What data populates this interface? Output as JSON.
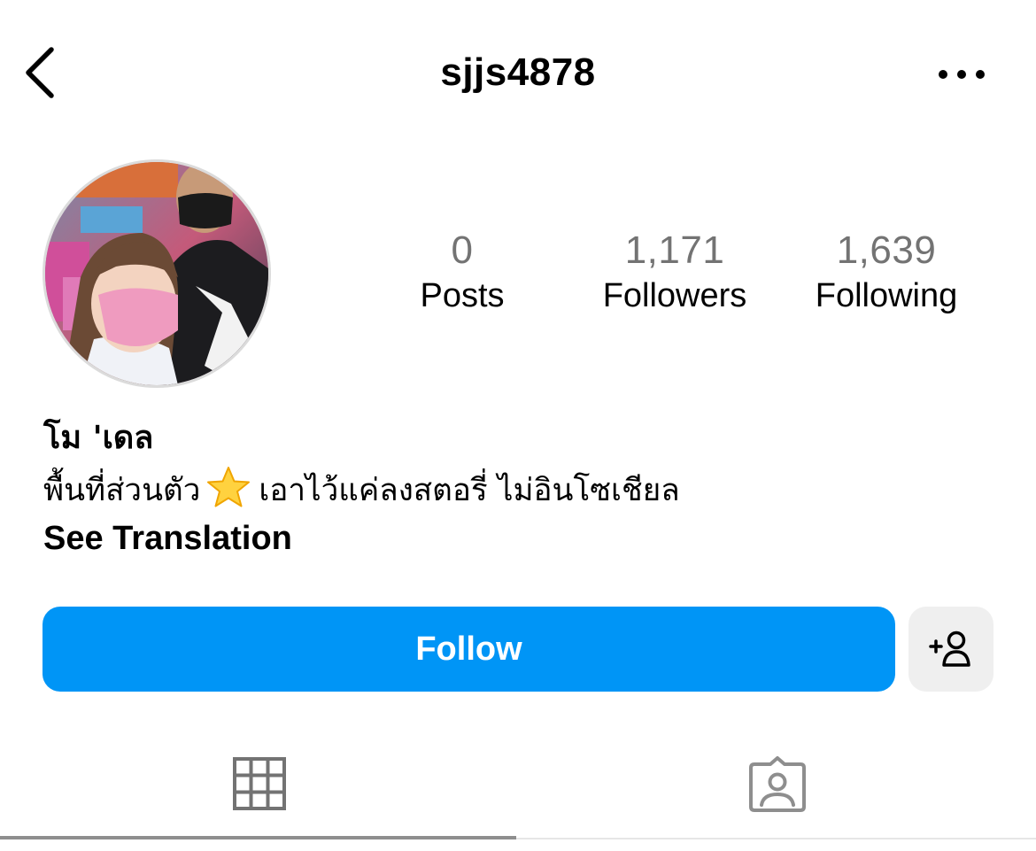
{
  "header": {
    "username": "sjjs4878",
    "back_icon": "chevron-left-icon",
    "more_icon": "more-horizontal-icon"
  },
  "profile": {
    "avatar": "profile-photo",
    "stats": [
      {
        "value": "0",
        "label": "Posts"
      },
      {
        "value": "1,171",
        "label": "Followers"
      },
      {
        "value": "1,639",
        "label": "Following"
      }
    ],
    "display_name": "โม 'เดล",
    "bio_before_emoji": "พื้นที่ส่วนตัว",
    "bio_emoji": "star-emoji",
    "bio_after_emoji": "เอาไว้แค่ลงสตอรี่ ไม่อินโซเชียล",
    "see_translation": "See Translation"
  },
  "actions": {
    "follow_label": "Follow",
    "suggest_icon": "add-person-icon"
  },
  "tabs": [
    {
      "icon": "grid-icon",
      "active": true
    },
    {
      "icon": "tagged-person-icon",
      "active": false
    }
  ],
  "colors": {
    "follow_button": "#0095f6",
    "secondary_button": "#efefef",
    "stat_number": "#737373",
    "tab_icon": "#737373",
    "tab_indicator": "#8e8e8e"
  }
}
